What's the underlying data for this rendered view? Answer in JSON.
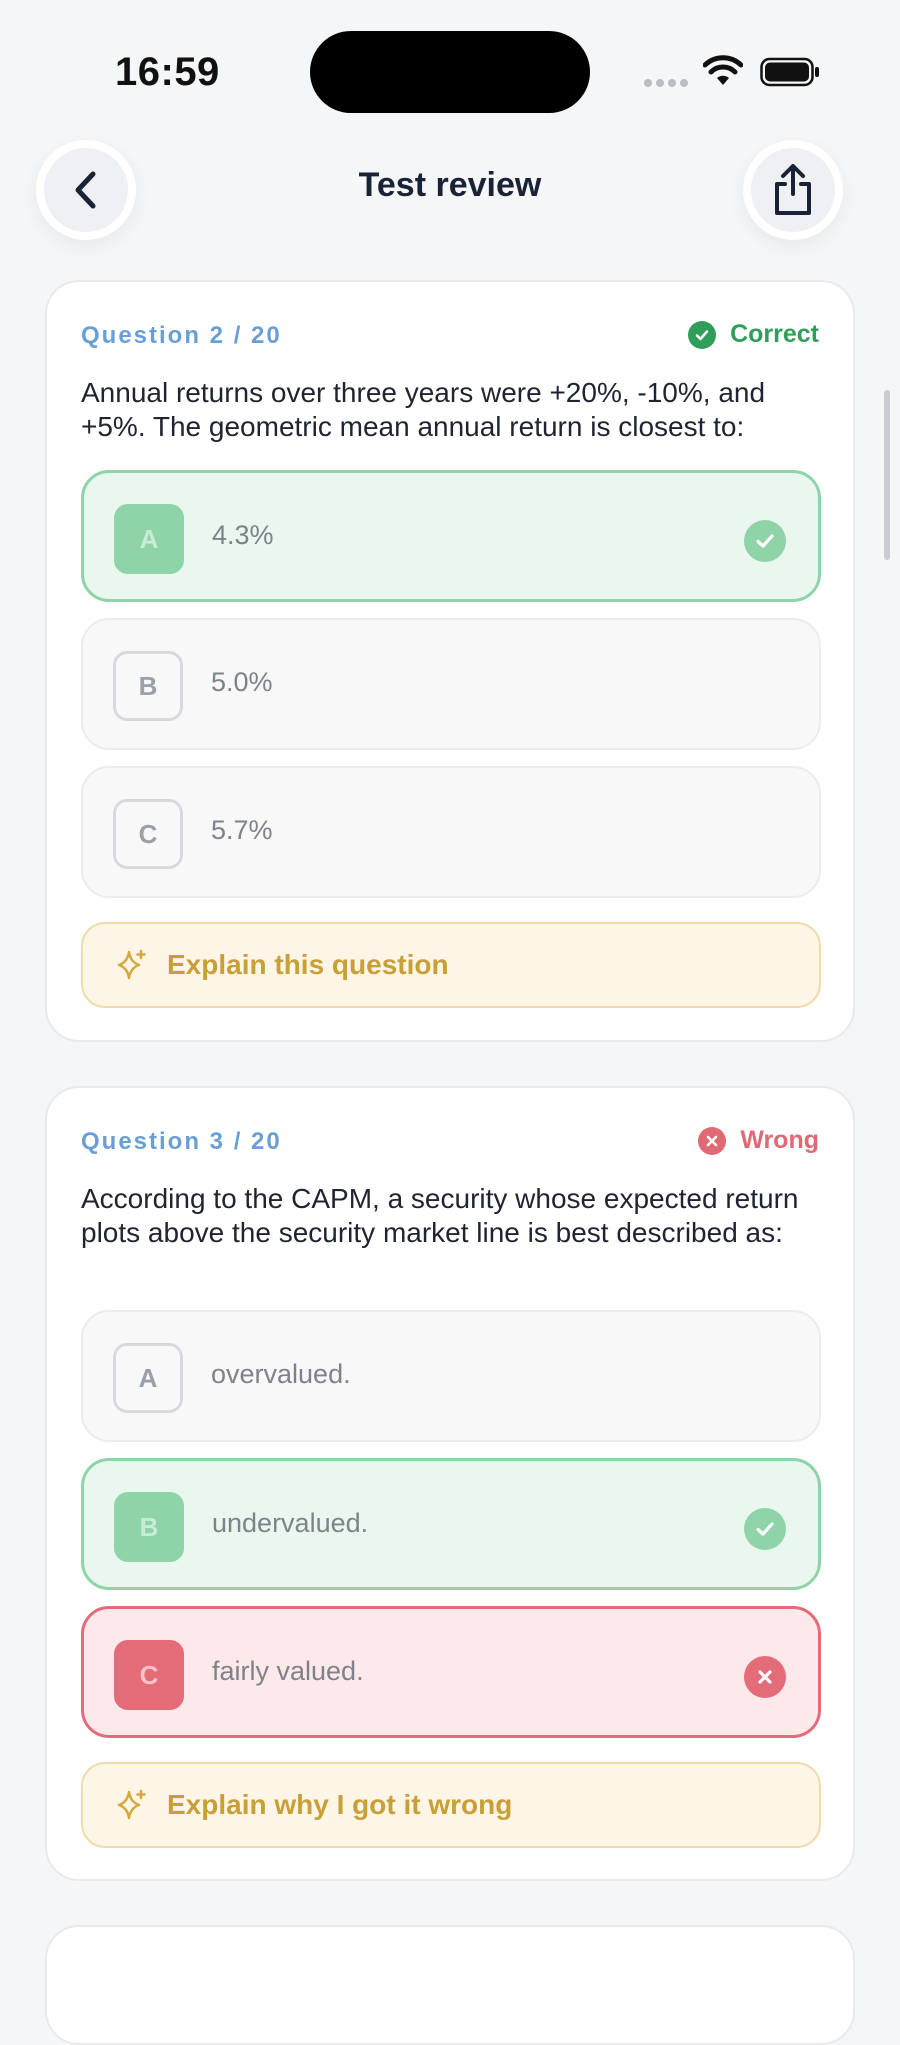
{
  "status_bar": {
    "time": "16:59"
  },
  "header": {
    "title": "Test review"
  },
  "questions": [
    {
      "number": "Question 2 / 20",
      "status": "Correct",
      "text": "Annual returns over three years were +20%, -10%, and +5%. The geometric mean annual return is closest to:",
      "options": [
        {
          "letter": "A",
          "text": "4.3%",
          "state": "correct"
        },
        {
          "letter": "B",
          "text": "5.0%",
          "state": "neutral"
        },
        {
          "letter": "C",
          "text": "5.7%",
          "state": "neutral"
        }
      ],
      "explain_label": "Explain this question"
    },
    {
      "number": "Question 3 / 20",
      "status": "Wrong",
      "text": "According to the CAPM, a security whose expected return plots above the security market line is best described as:",
      "options": [
        {
          "letter": "A",
          "text": "overvalued.",
          "state": "neutral"
        },
        {
          "letter": "B",
          "text": "undervalued.",
          "state": "correct"
        },
        {
          "letter": "C",
          "text": "fairly valued.",
          "state": "wrong"
        }
      ],
      "explain_label": "Explain why I got it wrong"
    }
  ],
  "colors": {
    "correct": "#2f9e5b",
    "wrong": "#e06a74",
    "accent_blue": "#6a9fd6",
    "explain_gold": "#c9a037"
  },
  "icons": {
    "back": "chevron-left-icon",
    "share": "share-icon",
    "correct": "check-circle-icon",
    "wrong": "x-circle-icon",
    "explain": "sparkle-icon"
  }
}
